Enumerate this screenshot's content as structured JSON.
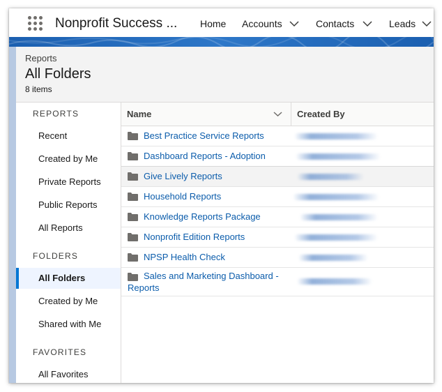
{
  "topnav": {
    "app_name": "Nonprofit Success ...",
    "items": [
      {
        "label": "Home"
      },
      {
        "label": "Accounts"
      },
      {
        "label": "Contacts"
      },
      {
        "label": "Leads"
      }
    ]
  },
  "header": {
    "breadcrumb": "Reports",
    "title": "All Folders",
    "count": "8 items"
  },
  "sidebar": {
    "reports_heading": "REPORTS",
    "reports_items": [
      "Recent",
      "Created by Me",
      "Private Reports",
      "Public Reports",
      "All Reports"
    ],
    "folders_heading": "FOLDERS",
    "folders_items": [
      "All Folders",
      "Created by Me",
      "Shared with Me"
    ],
    "folders_active": "All Folders",
    "favorites_heading": "FAVORITES",
    "favorites_items": [
      "All Favorites"
    ]
  },
  "table": {
    "columns": [
      "Name",
      "Created By"
    ],
    "rows": [
      {
        "name": "Best Practice Service Reports"
      },
      {
        "name": "Dashboard Reports - Adoption"
      },
      {
        "name": "Give Lively Reports"
      },
      {
        "name": "Household Reports"
      },
      {
        "name": "Knowledge Reports Package"
      },
      {
        "name": "Nonprofit Edition Reports"
      },
      {
        "name": "NPSP Health Check"
      },
      {
        "name": "Sales and Marketing Dashboard - Reports"
      }
    ],
    "highlighted_row": 2
  },
  "colors": {
    "link": "#0b5cab",
    "active_accent": "#0176d3",
    "banner": "#1b5fb0"
  }
}
